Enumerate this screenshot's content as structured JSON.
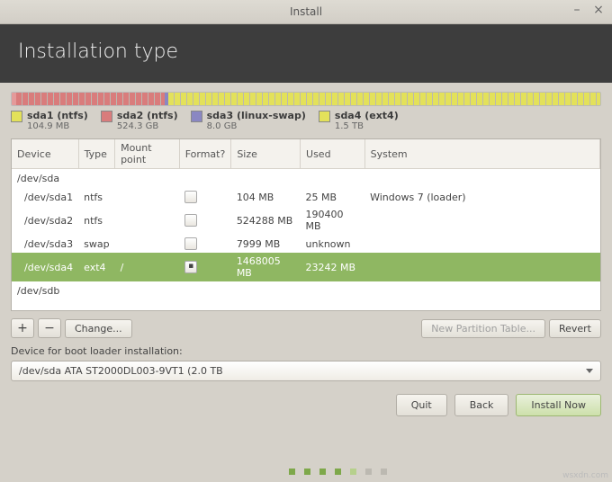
{
  "window": {
    "title": "Install"
  },
  "header": {
    "title": "Installation type"
  },
  "usage": [
    {
      "color": "#e49a9a",
      "pct": 0.7,
      "stripe": false
    },
    {
      "color": "#d97c7c",
      "pct": 25.3,
      "stripe": true
    },
    {
      "color": "#8a87c2",
      "pct": 0.6,
      "stripe": false
    },
    {
      "color": "#e3e15a",
      "pct": 73.4,
      "stripe": true
    }
  ],
  "legend": [
    {
      "color": "#e3e15a",
      "name": "sda1 (ntfs)",
      "size": "104.9 MB"
    },
    {
      "color": "#d97c7c",
      "name": "sda2 (ntfs)",
      "size": "524.3 GB"
    },
    {
      "color": "#8a87c2",
      "name": "sda3 (linux-swap)",
      "size": "8.0 GB"
    },
    {
      "color": "#e3e15a",
      "name": "sda4 (ext4)",
      "size": "1.5 TB"
    }
  ],
  "columns": {
    "device": "Device",
    "type": "Type",
    "mount": "Mount point",
    "format": "Format?",
    "size": "Size",
    "used": "Used",
    "system": "System"
  },
  "rows": [
    {
      "kind": "parent",
      "device": "/dev/sda"
    },
    {
      "kind": "part",
      "device": "/dev/sda1",
      "type": "ntfs",
      "mount": "",
      "format": false,
      "size": "104 MB",
      "used": "25 MB",
      "system": "Windows 7 (loader)"
    },
    {
      "kind": "part",
      "device": "/dev/sda2",
      "type": "ntfs",
      "mount": "",
      "format": false,
      "size": "524288 MB",
      "used": "190400 MB",
      "system": ""
    },
    {
      "kind": "part",
      "device": "/dev/sda3",
      "type": "swap",
      "mount": "",
      "format": false,
      "size": "7999 MB",
      "used": "unknown",
      "system": ""
    },
    {
      "kind": "part",
      "device": "/dev/sda4",
      "type": "ext4",
      "mount": "/",
      "format": true,
      "size": "1468005 MB",
      "used": "23242 MB",
      "system": "",
      "selected": true
    },
    {
      "kind": "parent",
      "device": "/dev/sdb"
    }
  ],
  "toolbar": {
    "add": "+",
    "remove": "−",
    "change": "Change...",
    "new_table": "New Partition Table...",
    "revert": "Revert"
  },
  "bootloader": {
    "label": "Device for boot loader installation:",
    "value": "/dev/sda   ATA ST2000DL003-9VT1 (2.0 TB"
  },
  "footer": {
    "quit": "Quit",
    "back": "Back",
    "install": "Install Now"
  },
  "progress_dots": [
    "done",
    "done",
    "done",
    "done",
    "cur",
    "idle",
    "idle"
  ],
  "watermark": "wsxdn.com"
}
